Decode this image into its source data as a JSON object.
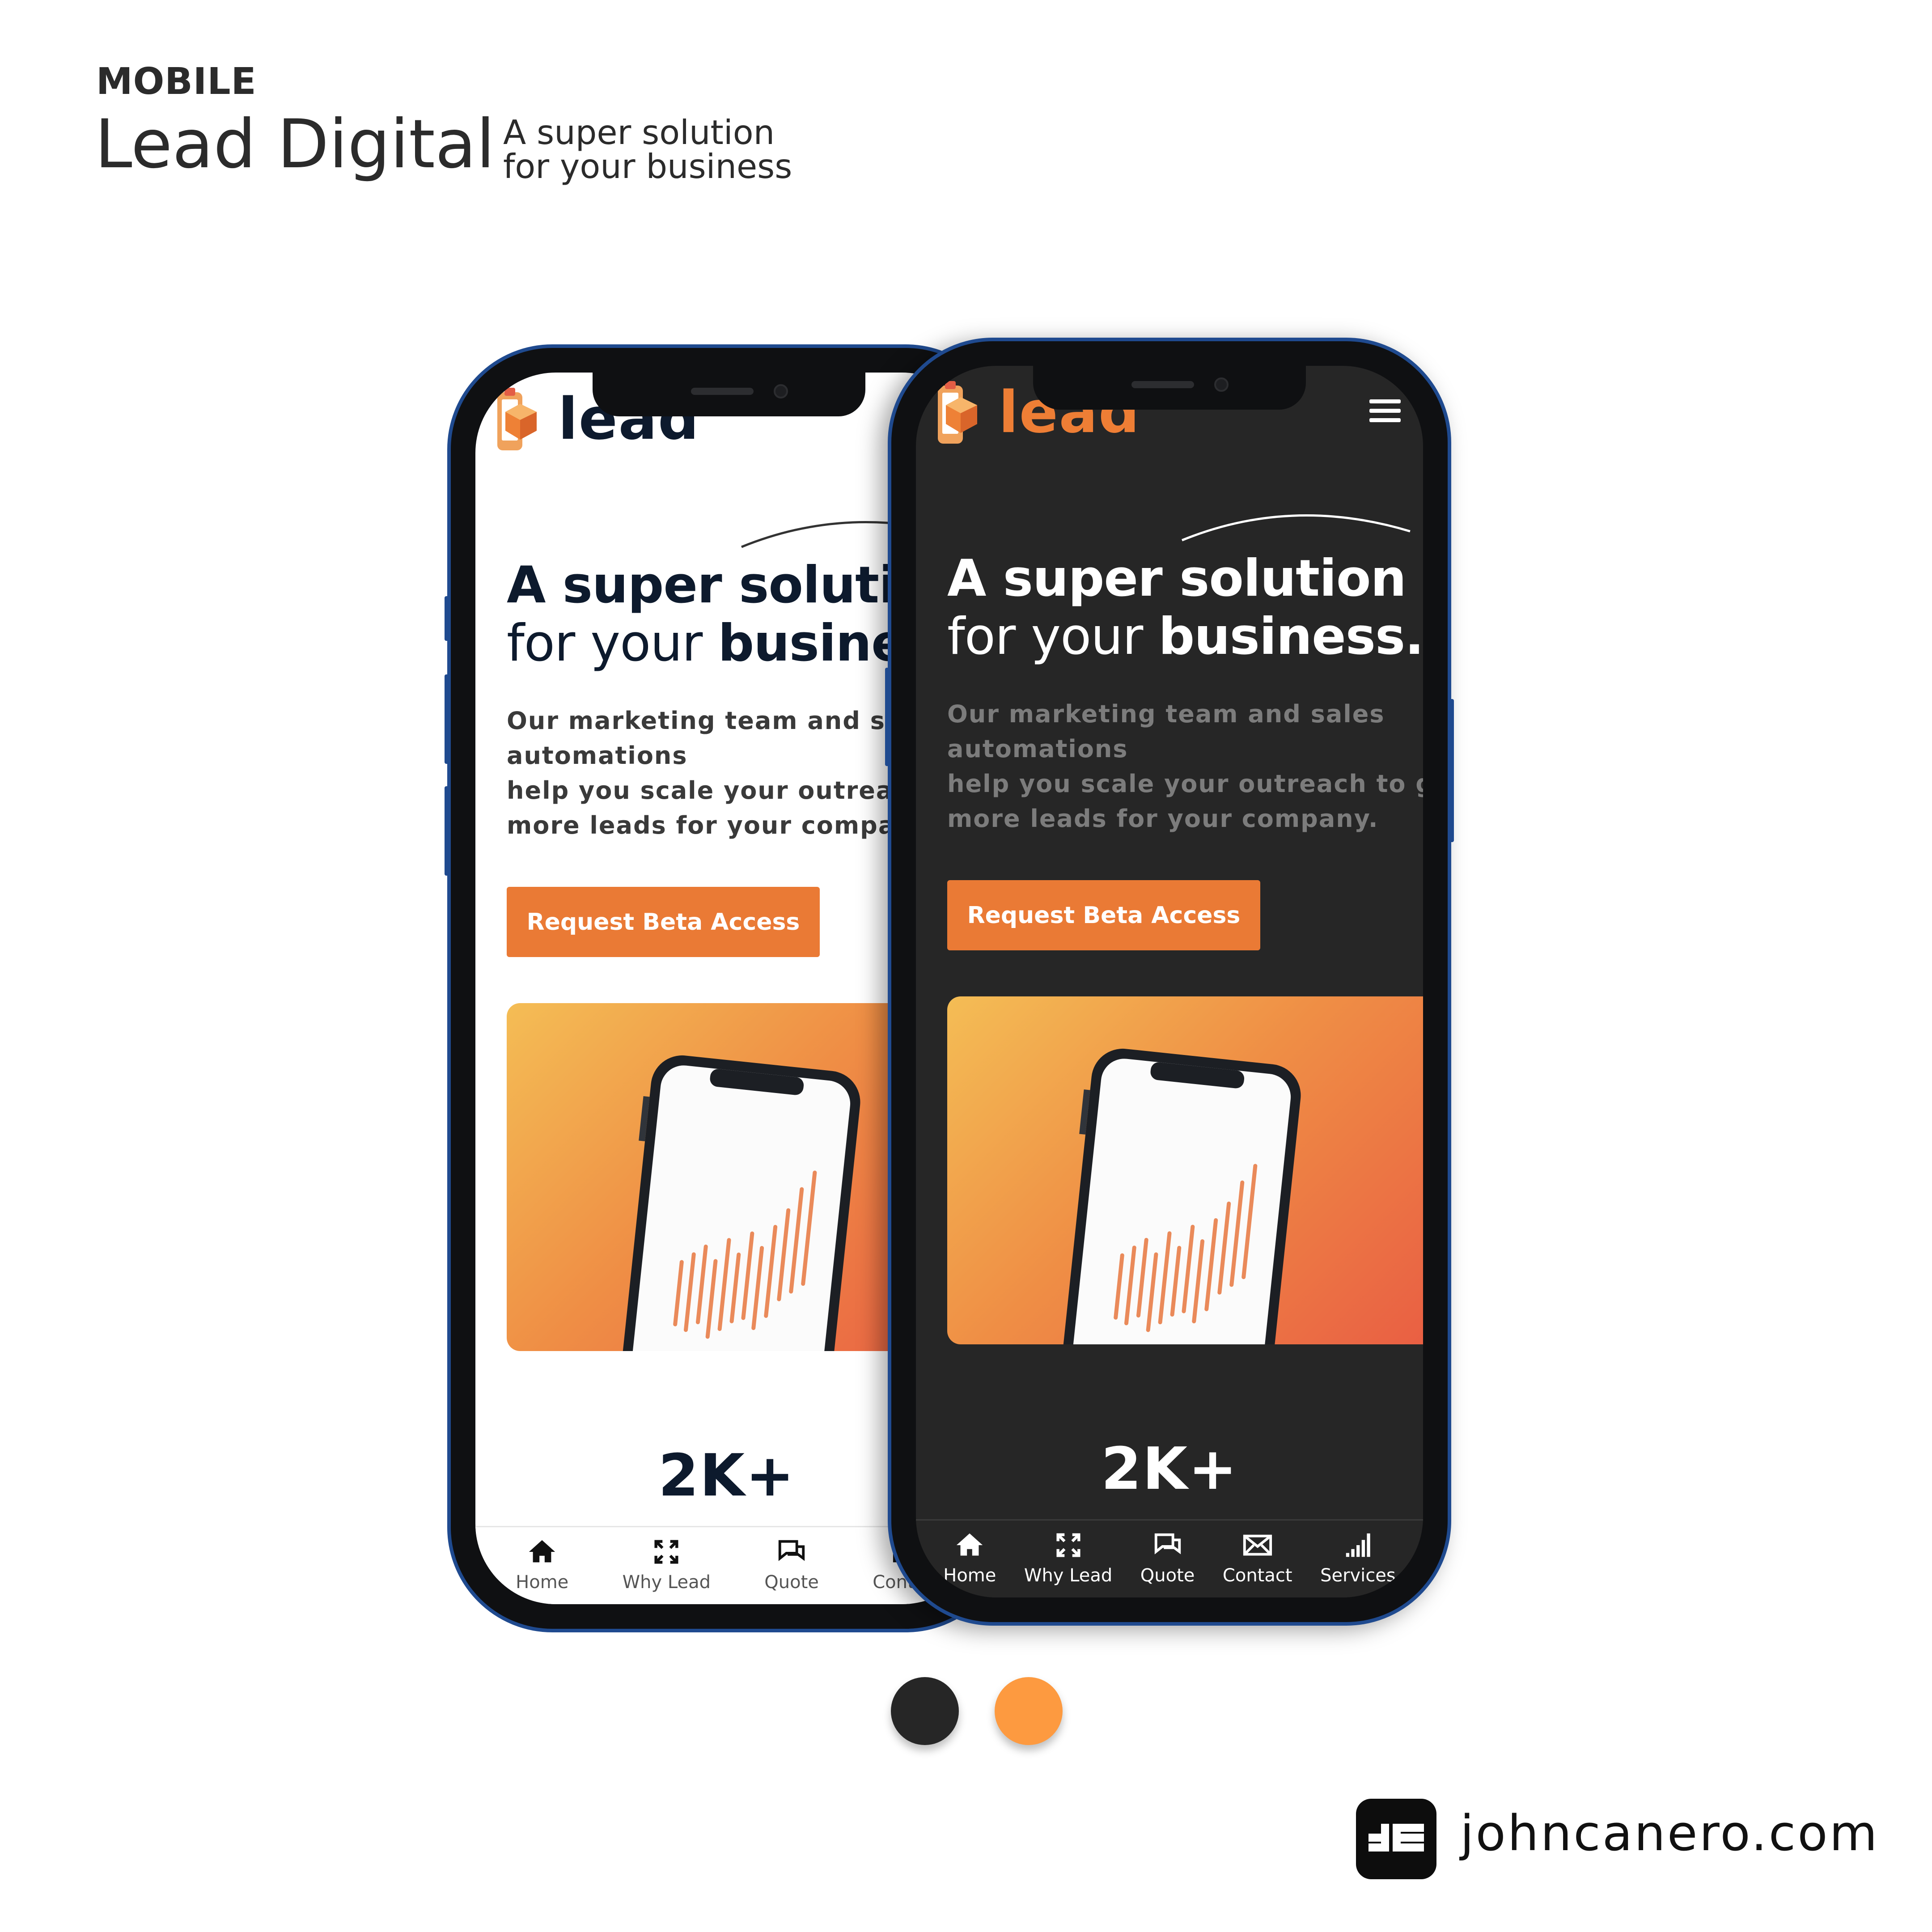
{
  "header": {
    "kicker": "MOBILE",
    "brand": "Lead Digital",
    "tagline_line1": "A super solution",
    "tagline_line2": "for your business"
  },
  "light_phone": {
    "logo_text": "lead",
    "hero_line1": "A super solution",
    "hero_line2_a": "for your ",
    "hero_line2_b": "business.",
    "copy_line1": "Our marketing team and sales",
    "copy_line2": "automations",
    "copy_line3": "help you scale your outreach to get",
    "copy_line4": "more leads for your company.",
    "cta_label": "Request Beta Access",
    "stat": "2K+",
    "tabs": [
      {
        "label": "Home",
        "icon": "home-icon"
      },
      {
        "label": "Why Lead",
        "icon": "expand-icon"
      },
      {
        "label": "Quote",
        "icon": "chat-icon"
      },
      {
        "label": "Contact",
        "icon": "mail-icon"
      }
    ]
  },
  "dark_phone": {
    "logo_text": "lead",
    "hero_line1": "A super solution",
    "hero_line2_a": "for your ",
    "hero_line2_b": "business.",
    "copy_line1": "Our marketing team and sales",
    "copy_line2": "automations",
    "copy_line3": "help you scale your outreach to get",
    "copy_line4": "more leads for your company.",
    "cta_label": "Request Beta Access",
    "stat": "2K+",
    "tabs": [
      {
        "label": "Home",
        "icon": "home-icon"
      },
      {
        "label": "Why Lead",
        "icon": "expand-icon"
      },
      {
        "label": "Quote",
        "icon": "chat-icon"
      },
      {
        "label": "Contact",
        "icon": "mail-icon"
      },
      {
        "label": "Services",
        "icon": "signal-icon"
      }
    ]
  },
  "palette": {
    "dark": "#262626",
    "accent": "#fd9a40"
  },
  "footer": {
    "website": "johncanero.com"
  }
}
